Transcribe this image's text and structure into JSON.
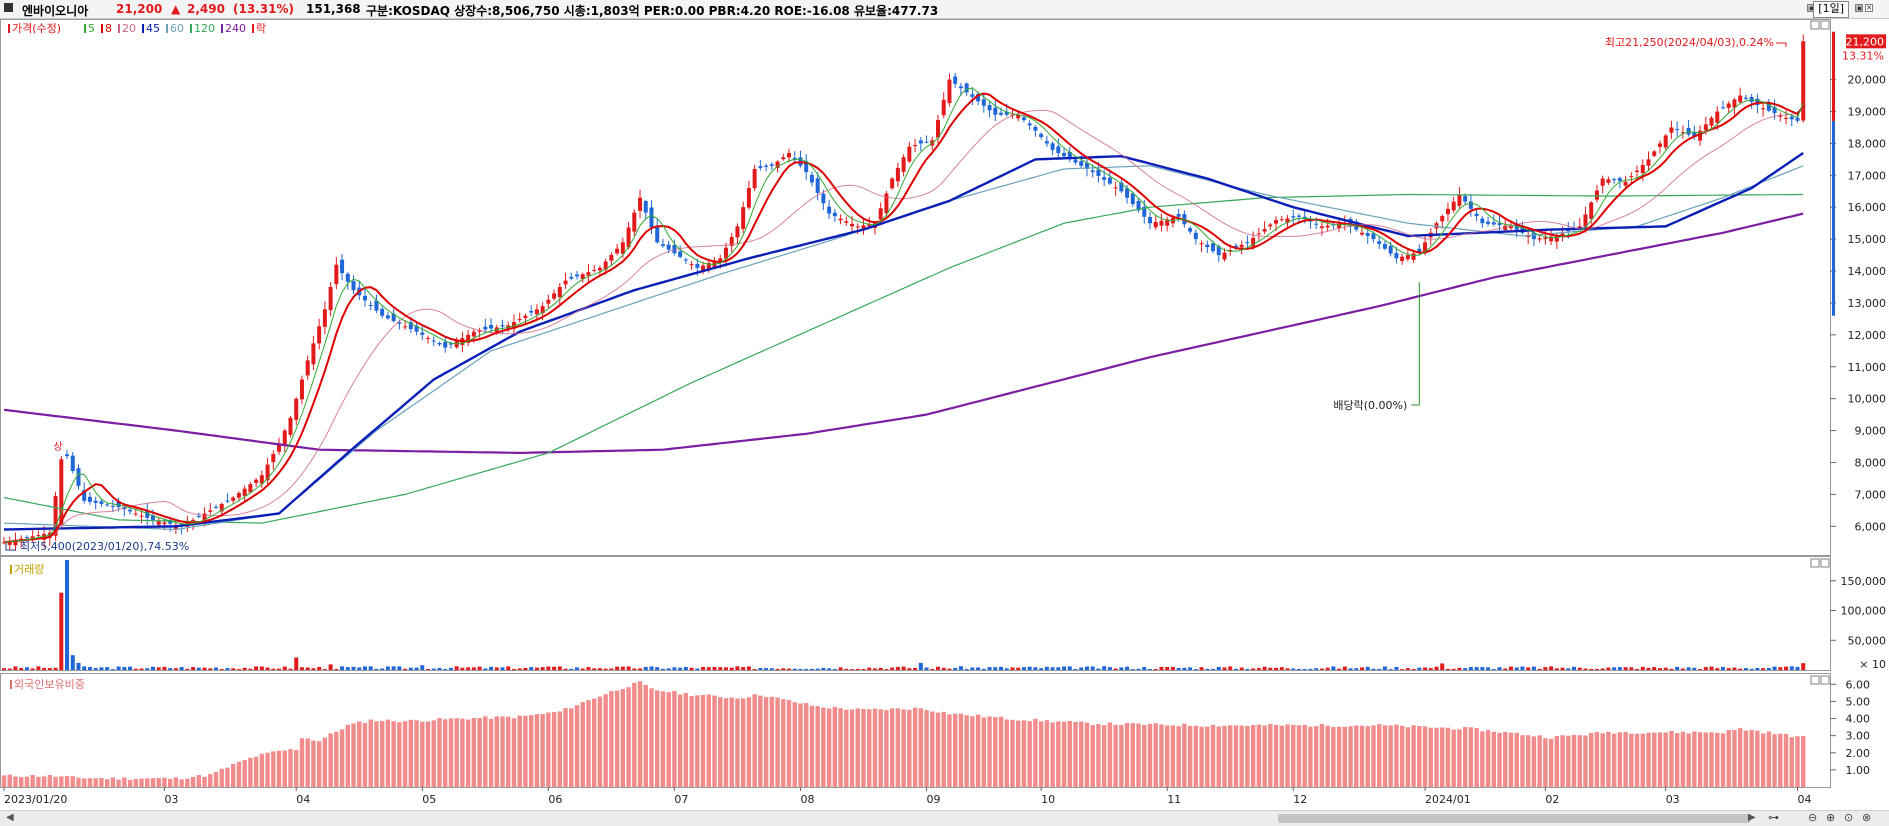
{
  "header": {
    "stock_name": "엔바이오니아",
    "price": "21,200",
    "change_arrow": "▲",
    "change": "2,490",
    "change_pct": "(13.31%)",
    "volume": "151,368",
    "info": "구분:KOSDAQ  상장수:8,506,750  시총:1,803억  PER:0.00  PBR:4.20  ROE:-16.08  유보율:477.73",
    "period": "[1일]"
  },
  "colors": {
    "up": "#e31a1c",
    "down": "#1f66d8",
    "ma5": "#33aa33",
    "ma8": "#dd0000",
    "ma20": "#cc6688",
    "ma45": "#0a1fb8",
    "ma60": "#6aa2bb",
    "ma120": "#36a85a",
    "ma240": "#7b1fa2",
    "foreign_bar": "#f28b8b"
  },
  "chart_data": [
    {
      "type": "candlestick",
      "title": "가격(수정)",
      "legend": [
        {
          "name": "가격(수정)",
          "color": "#e31a1c"
        },
        {
          "name": "5",
          "color": "#33aa33"
        },
        {
          "name": "8",
          "color": "#dd0000"
        },
        {
          "name": "20",
          "color": "#cc6688"
        },
        {
          "name": "45",
          "color": "#0a1fb8"
        },
        {
          "name": "60",
          "color": "#6aa2bb"
        },
        {
          "name": "120",
          "color": "#36a85a"
        },
        {
          "name": "240",
          "color": "#7b1fa2"
        },
        {
          "name": "락",
          "color": "#e31a1c"
        }
      ],
      "x_ticks": [
        "2023/01/20",
        "03",
        "04",
        "05",
        "06",
        "07",
        "08",
        "09",
        "10",
        "11",
        "12",
        "2024/01",
        "02",
        "03",
        "04"
      ],
      "x_tick_index": [
        0,
        28,
        51,
        73,
        95,
        117,
        139,
        161,
        181,
        203,
        225,
        248,
        269,
        290,
        313
      ],
      "y_ticks": [
        "6,000",
        "7,000",
        "8,000",
        "9,000",
        "10,000",
        "11,000",
        "12,000",
        "13,000",
        "14,000",
        "15,000",
        "16,000",
        "17,000",
        "18,000",
        "19,000",
        "20,000",
        "21,200"
      ],
      "ylim": [
        5100,
        21900
      ],
      "close_anchors": [
        [
          0,
          5500
        ],
        [
          8,
          5800
        ],
        [
          10,
          8100
        ],
        [
          11,
          8200
        ],
        [
          14,
          6800
        ],
        [
          20,
          6600
        ],
        [
          26,
          6200
        ],
        [
          31,
          6000
        ],
        [
          35,
          6400
        ],
        [
          40,
          6900
        ],
        [
          45,
          7600
        ],
        [
          48,
          8600
        ],
        [
          50,
          9400
        ],
        [
          53,
          11200
        ],
        [
          56,
          12800
        ],
        [
          58,
          14200
        ],
        [
          61,
          13400
        ],
        [
          66,
          12600
        ],
        [
          72,
          12100
        ],
        [
          77,
          11600
        ],
        [
          82,
          12100
        ],
        [
          88,
          12300
        ],
        [
          94,
          12900
        ],
        [
          98,
          13700
        ],
        [
          104,
          14100
        ],
        [
          108,
          14900
        ],
        [
          111,
          16300
        ],
        [
          114,
          14900
        ],
        [
          121,
          14100
        ],
        [
          125,
          14400
        ],
        [
          128,
          15400
        ],
        [
          131,
          17200
        ],
        [
          134,
          17300
        ],
        [
          137,
          17700
        ],
        [
          140,
          17100
        ],
        [
          144,
          15800
        ],
        [
          149,
          15400
        ],
        [
          152,
          15500
        ],
        [
          155,
          16900
        ],
        [
          158,
          17900
        ],
        [
          162,
          18100
        ],
        [
          165,
          20000
        ],
        [
          168,
          19600
        ],
        [
          173,
          18900
        ],
        [
          177,
          18900
        ],
        [
          180,
          18400
        ],
        [
          183,
          17800
        ],
        [
          190,
          17100
        ],
        [
          195,
          16500
        ],
        [
          200,
          15500
        ],
        [
          205,
          15700
        ],
        [
          208,
          15000
        ],
        [
          212,
          14500
        ],
        [
          217,
          14900
        ],
        [
          222,
          15600
        ],
        [
          226,
          15700
        ],
        [
          230,
          15400
        ],
        [
          234,
          15500
        ],
        [
          239,
          15000
        ],
        [
          243,
          14400
        ],
        [
          247,
          14600
        ],
        [
          250,
          15500
        ],
        [
          254,
          16400
        ],
        [
          258,
          15500
        ],
        [
          263,
          15400
        ],
        [
          267,
          15000
        ],
        [
          271,
          15100
        ],
        [
          275,
          15400
        ],
        [
          279,
          16900
        ],
        [
          283,
          16800
        ],
        [
          287,
          17500
        ],
        [
          291,
          18500
        ],
        [
          295,
          18200
        ],
        [
          299,
          19000
        ],
        [
          303,
          19500
        ],
        [
          307,
          19100
        ],
        [
          311,
          18800
        ],
        [
          313,
          18710
        ],
        [
          314,
          21200
        ]
      ],
      "ma_anchors": {
        "ma240": [
          [
            0,
            9650
          ],
          [
            30,
            9000
          ],
          [
            55,
            8400
          ],
          [
            90,
            8300
          ],
          [
            115,
            8400
          ],
          [
            140,
            8900
          ],
          [
            161,
            9500
          ],
          [
            200,
            11300
          ],
          [
            240,
            12900
          ],
          [
            260,
            13800
          ],
          [
            280,
            14500
          ],
          [
            300,
            15200
          ],
          [
            314,
            15800
          ]
        ],
        "ma120": [
          [
            0,
            6900
          ],
          [
            20,
            6200
          ],
          [
            45,
            6100
          ],
          [
            70,
            7000
          ],
          [
            95,
            8300
          ],
          [
            120,
            10500
          ],
          [
            145,
            12500
          ],
          [
            165,
            14100
          ],
          [
            185,
            15500
          ],
          [
            200,
            16000
          ],
          [
            220,
            16300
          ],
          [
            245,
            16400
          ],
          [
            280,
            16350
          ],
          [
            314,
            16400
          ]
        ],
        "ma60": [
          [
            0,
            6100
          ],
          [
            30,
            5900
          ],
          [
            48,
            6400
          ],
          [
            65,
            9000
          ],
          [
            85,
            11500
          ],
          [
            105,
            12700
          ],
          [
            125,
            13900
          ],
          [
            145,
            15000
          ],
          [
            165,
            16200
          ],
          [
            185,
            17200
          ],
          [
            200,
            17300
          ],
          [
            220,
            16400
          ],
          [
            245,
            15500
          ],
          [
            265,
            15100
          ],
          [
            285,
            15400
          ],
          [
            300,
            16300
          ],
          [
            314,
            17300
          ]
        ],
        "ma45": [
          [
            0,
            5900
          ],
          [
            30,
            6000
          ],
          [
            48,
            6400
          ],
          [
            60,
            8300
          ],
          [
            75,
            10600
          ],
          [
            90,
            12100
          ],
          [
            110,
            13400
          ],
          [
            130,
            14400
          ],
          [
            150,
            15300
          ],
          [
            165,
            16200
          ],
          [
            180,
            17500
          ],
          [
            195,
            17600
          ],
          [
            210,
            16900
          ],
          [
            225,
            16000
          ],
          [
            245,
            15100
          ],
          [
            270,
            15300
          ],
          [
            290,
            15400
          ],
          [
            305,
            16600
          ],
          [
            314,
            17700
          ]
        ]
      },
      "annotations": {
        "high": "최고21,250(2024/04/03),0.24%",
        "low": "최저5,400(2023/01/20),74.53%",
        "dividend": "배당락(0.00%)",
        "limit_up": "상",
        "last_price": "21,200",
        "last_pct": "13.31%"
      }
    },
    {
      "type": "bar",
      "title": "거래량",
      "y_ticks": [
        "50,000",
        "100,000",
        "150,000"
      ],
      "y_unit": "× 10",
      "ylim": [
        0,
        190000
      ],
      "spikes": [
        [
          10,
          130000
        ],
        [
          11,
          185000
        ],
        [
          12,
          25000
        ],
        [
          13,
          12000
        ],
        [
          51,
          21000
        ],
        [
          57,
          9500
        ],
        [
          73,
          8000
        ],
        [
          97,
          6000
        ],
        [
          160,
          12000
        ],
        [
          251,
          11000
        ],
        [
          314,
          11500
        ]
      ],
      "base_level": 3500
    },
    {
      "type": "bar",
      "title": "외국인보유비중",
      "y_ticks": [
        "1.00",
        "2.00",
        "3.00",
        "4.00",
        "5.00",
        "6.00"
      ],
      "ylim": [
        0,
        6.6
      ],
      "anchors": [
        [
          0,
          0.65
        ],
        [
          8,
          0.65
        ],
        [
          12,
          0.55
        ],
        [
          18,
          0.5
        ],
        [
          30,
          0.5
        ],
        [
          36,
          0.7
        ],
        [
          40,
          1.3
        ],
        [
          44,
          1.8
        ],
        [
          48,
          2.1
        ],
        [
          51,
          2.2
        ],
        [
          52,
          2.9
        ],
        [
          55,
          2.7
        ],
        [
          60,
          3.6
        ],
        [
          64,
          3.9
        ],
        [
          70,
          3.85
        ],
        [
          80,
          4.0
        ],
        [
          90,
          4.1
        ],
        [
          97,
          4.4
        ],
        [
          103,
          5.2
        ],
        [
          108,
          5.8
        ],
        [
          111,
          6.1
        ],
        [
          113,
          5.7
        ],
        [
          120,
          5.4
        ],
        [
          128,
          5.2
        ],
        [
          132,
          5.4
        ],
        [
          136,
          5.1
        ],
        [
          142,
          4.7
        ],
        [
          150,
          4.5
        ],
        [
          160,
          4.6
        ],
        [
          165,
          4.3
        ],
        [
          175,
          4.0
        ],
        [
          190,
          3.7
        ],
        [
          210,
          3.6
        ],
        [
          240,
          3.6
        ],
        [
          256,
          3.4
        ],
        [
          270,
          2.9
        ],
        [
          280,
          3.2
        ],
        [
          300,
          3.2
        ],
        [
          303,
          3.4
        ],
        [
          314,
          2.9
        ]
      ]
    }
  ]
}
